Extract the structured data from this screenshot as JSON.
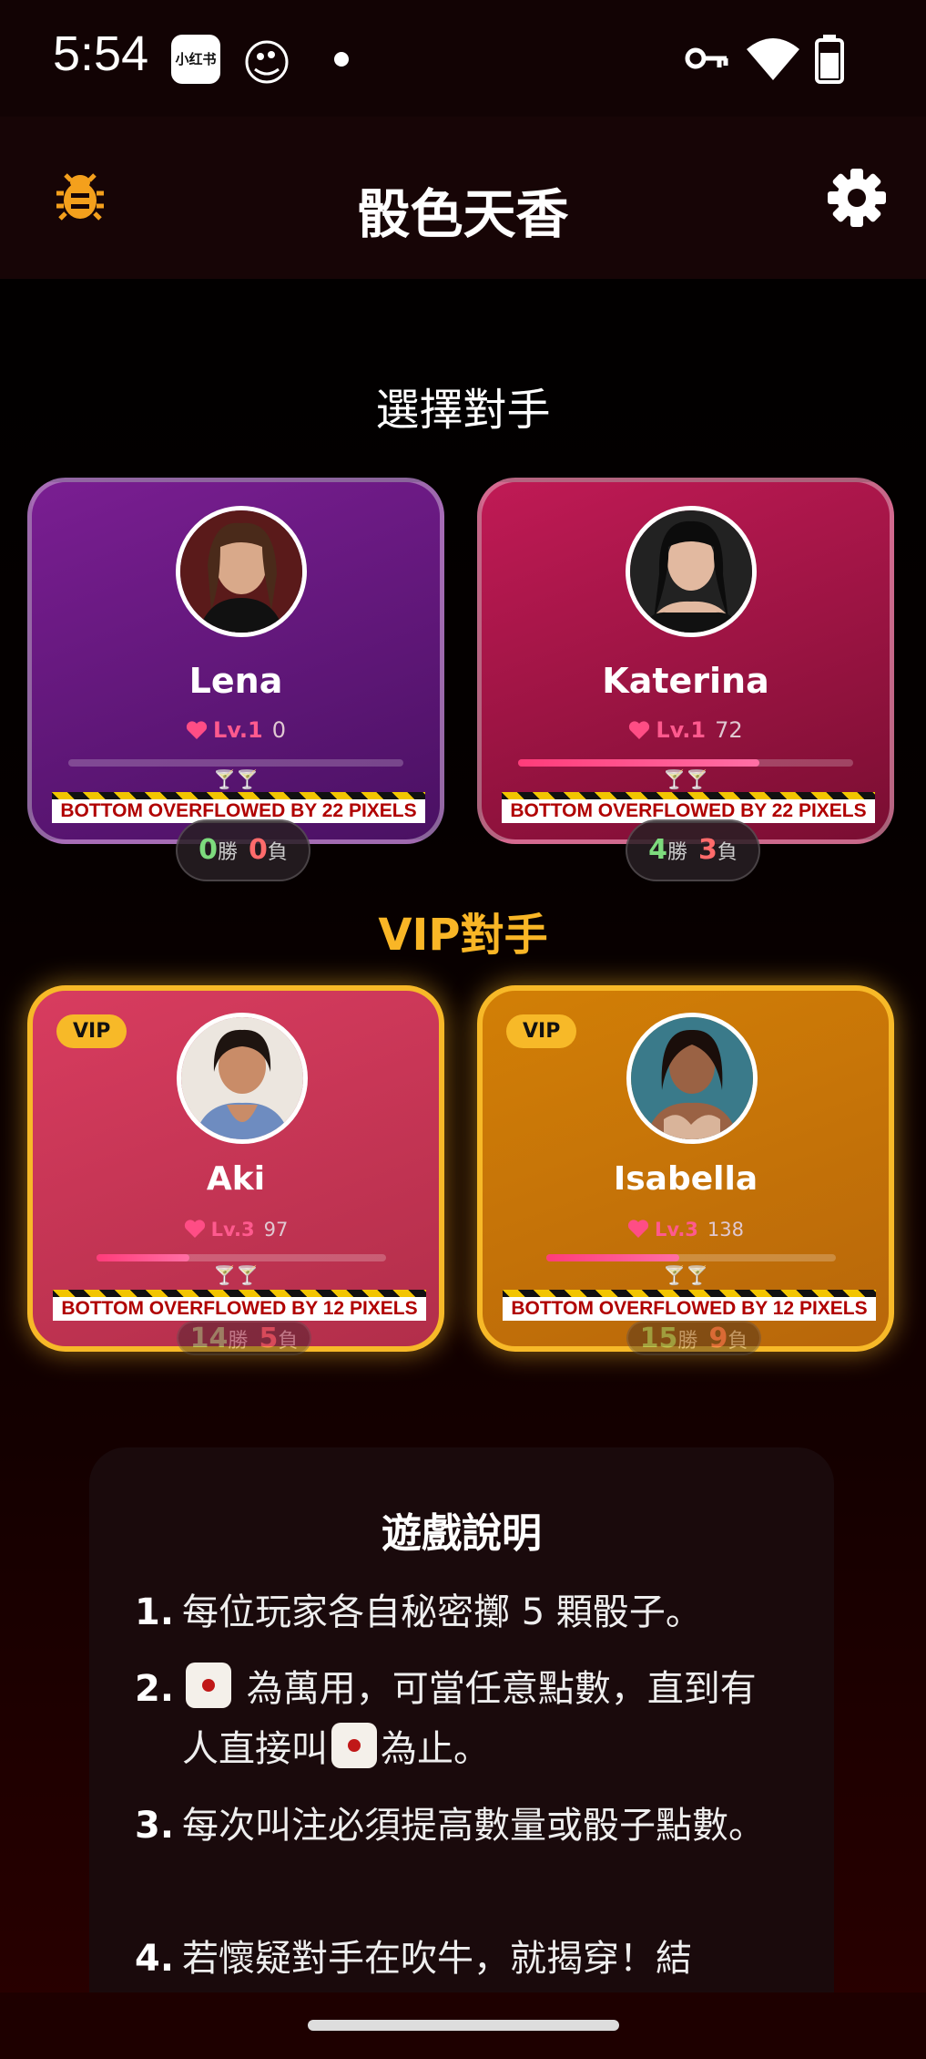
{
  "status_bar": {
    "time": "5:54",
    "app1_label": "小红书"
  },
  "app_bar": {
    "title": "骰色天香"
  },
  "section_opponents": "選擇對手",
  "section_vip": "VIP對手",
  "opponents": [
    {
      "name": "Lena",
      "level": "Lv.1",
      "affection": "0",
      "progress": 0.0,
      "glasses": "🍸🍸",
      "overflow": "BOTTOM OVERFLOWED BY 22 PIXELS",
      "wins": "0",
      "wins_label": "勝",
      "losses": "0",
      "losses_label": "負"
    },
    {
      "name": "Katerina",
      "level": "Lv.1",
      "affection": "72",
      "progress": 0.72,
      "glasses": "🍸🍸",
      "overflow": "BOTTOM OVERFLOWED BY 22 PIXELS",
      "wins": "4",
      "wins_label": "勝",
      "losses": "3",
      "losses_label": "負"
    }
  ],
  "vip_opponents": [
    {
      "badge": "VIP",
      "name": "Aki",
      "level": "Lv.3",
      "affection": "97",
      "progress": 0.32,
      "glasses": "🍸🍸",
      "overflow": "BOTTOM OVERFLOWED BY 12 PIXELS",
      "wins": "14",
      "wins_label": "勝",
      "losses": "5",
      "losses_label": "負"
    },
    {
      "badge": "VIP",
      "name": "Isabella",
      "level": "Lv.3",
      "affection": "138",
      "progress": 0.46,
      "glasses": "🍸🍸",
      "overflow": "BOTTOM OVERFLOWED BY 12 PIXELS",
      "wins": "15",
      "wins_label": "勝",
      "losses": "9",
      "losses_label": "負"
    }
  ],
  "rules": {
    "title": "遊戲說明",
    "items": [
      {
        "num": "1.",
        "text": "每位玩家各自秘密擲 5 顆骰子。"
      },
      {
        "num": "2.",
        "text_a": "為萬用，可當任意點數，直到有人直接叫",
        "text_b": "為止。"
      },
      {
        "num": "3.",
        "text": "每次叫注必須提高數量或骰子點數。"
      },
      {
        "num": "4.",
        "text": "若懷疑對手在吹牛，就揭穿！結"
      }
    ]
  }
}
